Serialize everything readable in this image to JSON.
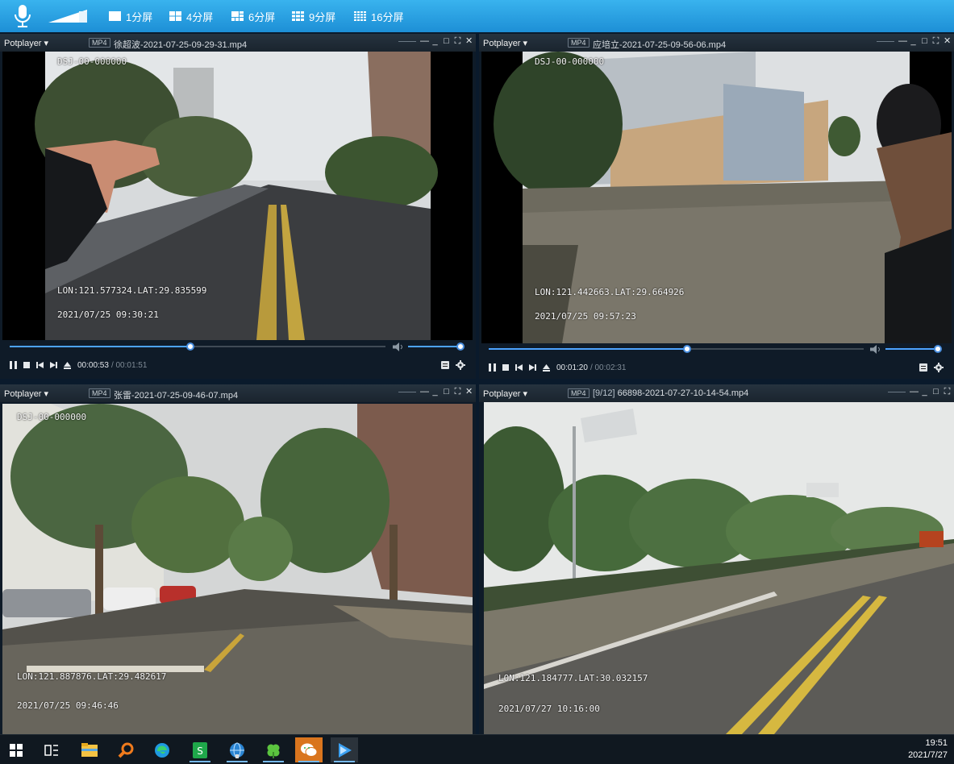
{
  "toolbar": {
    "icons": {
      "mic": "microphone-icon",
      "volume": "volume-level-icon"
    },
    "layouts": [
      {
        "label": "1分屏",
        "icon": "layout-1-icon"
      },
      {
        "label": "4分屏",
        "icon": "layout-4-icon"
      },
      {
        "label": "6分屏",
        "icon": "layout-6-icon"
      },
      {
        "label": "9分屏",
        "icon": "layout-9-icon"
      },
      {
        "label": "16分屏",
        "icon": "layout-16-icon"
      }
    ],
    "colors": {
      "bar": "#2aa3e6"
    }
  },
  "players": [
    {
      "brand": "Potplayer ▾",
      "format": "MP4",
      "filename": "徐超波-2021-07-25-09-29-31.mp4",
      "osd": {
        "device": "DSJ-00-000000",
        "coords": "LON:121.577324.LAT:29.835599",
        "datetime": "2021/07/25 09:30:21"
      },
      "current_time": "00:00:53",
      "total_time": "/ 00:01:51",
      "progress": 0.48
    },
    {
      "brand": "Potplayer ▾",
      "format": "MP4",
      "filename": "应培立-2021-07-25-09-56-06.mp4",
      "osd": {
        "device": "DSJ-00-000000",
        "coords": "LON:121.442663.LAT:29.664926",
        "datetime": "2021/07/25 09:57:23"
      },
      "current_time": "00:01:20",
      "total_time": "/ 00:02:31",
      "progress": 0.53
    },
    {
      "brand": "Potplayer ▾",
      "format": "MP4",
      "filename": "张雷-2021-07-25-09-46-07.mp4",
      "osd": {
        "device": "DSJ-00-000000",
        "coords": "LON:121.887876.LAT:29.482617",
        "datetime": "2021/07/25 09:46:46"
      }
    },
    {
      "brand": "Potplayer ▾",
      "format": "MP4",
      "playlist_pos": "[9/12]",
      "filename": "66898-2021-07-27-10-14-54.mp4",
      "osd": {
        "coords": "LON:121.184777.LAT:30.032157",
        "datetime": "2021/07/27 10:16:00"
      }
    }
  ],
  "window_controls": [
    "—",
    "_",
    "□",
    "⛶",
    "✕"
  ],
  "taskbar": {
    "apps": [
      "windows-start-icon",
      "task-view-icon",
      "file-explorer-icon",
      "search-app-icon",
      "edge-browser-icon",
      "spreadsheet-app-icon",
      "network-globe-icon",
      "clover-app-icon",
      "wechat-icon",
      "potplayer-icon"
    ],
    "time": "19:51",
    "date": "2021/7/27"
  }
}
